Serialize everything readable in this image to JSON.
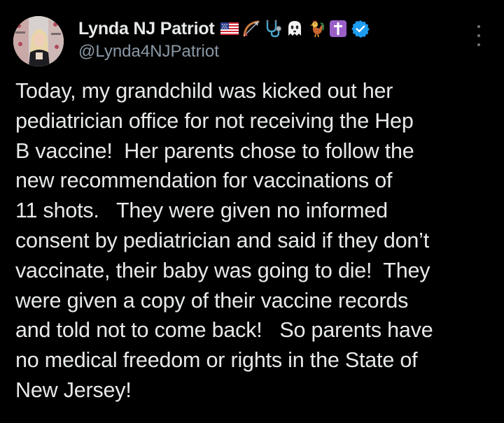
{
  "post": {
    "author": {
      "display_name": "Lynda NJ Patriot",
      "handle": "@Lynda4NJPatriot",
      "verified": true,
      "name_emojis": [
        "us-flag-icon",
        "bow-and-arrow-icon",
        "stethoscope-icon",
        "ghost-icon",
        "rooster-icon",
        "latin-cross-icon"
      ]
    },
    "body_lines": [
      "Today, my grandchild was kicked out her",
      "pediatrician office for not receiving the Hep",
      "B vaccine!  Her parents chose to follow the",
      "new recommendation for vaccinations of",
      "11 shots.   They were given no informed",
      "consent by pediatrician and said if they don’t",
      "vaccinate, their baby was going to die!  They",
      "were given a copy of their vaccine records",
      "and told not to come back!   So parents have",
      "no medical freedom or rights in the State of",
      "New Jersey!"
    ]
  },
  "colors": {
    "background": "#000000",
    "text_primary": "#e7e9ea",
    "text_secondary": "#8b98a5",
    "verified_blue": "#1d9bf0"
  }
}
